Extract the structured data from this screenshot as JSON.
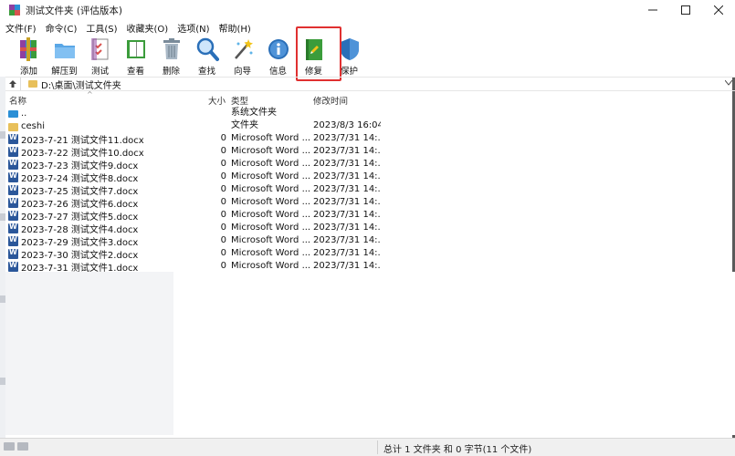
{
  "window": {
    "title": "测试文件夹 (评估版本)",
    "minimize_icon": "minimize-icon",
    "maximize_icon": "maximize-icon",
    "close_icon": "close-icon"
  },
  "menu": [
    "文件(F)",
    "命令(C)",
    "工具(S)",
    "收藏夹(O)",
    "选项(N)",
    "帮助(H)"
  ],
  "toolbar": [
    {
      "label": "添加",
      "icon": "add-archive-icon"
    },
    {
      "label": "解压到",
      "icon": "extract-folder-icon"
    },
    {
      "label": "测试",
      "icon": "test-checklist-icon"
    },
    {
      "label": "查看",
      "icon": "view-book-icon"
    },
    {
      "label": "删除",
      "icon": "trash-icon"
    },
    {
      "label": "查找",
      "icon": "magnifier-icon"
    },
    {
      "label": "向导",
      "icon": "wizard-wand-icon"
    },
    {
      "label": "信息",
      "icon": "info-icon"
    },
    {
      "label": "修复",
      "icon": "repair-book-icon"
    },
    {
      "label": "保护",
      "icon": "shield-icon"
    }
  ],
  "address": {
    "up_icon": "up-arrow-icon",
    "path": "D:\\桌面\\测试文件夹",
    "dropdown_icon": "chevron-down-icon"
  },
  "columns": {
    "name": "名称",
    "size": "大小",
    "type": "类型",
    "modified": "修改时间"
  },
  "files": [
    {
      "name": "..",
      "size": "",
      "type": "系统文件夹",
      "modified": "",
      "kind": "up"
    },
    {
      "name": "ceshi",
      "size": "",
      "type": "文件夹",
      "modified": "2023/8/3 16:04",
      "kind": "folder"
    },
    {
      "name": "2023-7-21 测试文件11.docx",
      "size": "0",
      "type": "Microsoft Word ...",
      "modified": "2023/7/31 14:...",
      "kind": "word"
    },
    {
      "name": "2023-7-22 测试文件10.docx",
      "size": "0",
      "type": "Microsoft Word ...",
      "modified": "2023/7/31 14:...",
      "kind": "word"
    },
    {
      "name": "2023-7-23 测试文件9.docx",
      "size": "0",
      "type": "Microsoft Word ...",
      "modified": "2023/7/31 14:...",
      "kind": "word"
    },
    {
      "name": "2023-7-24 测试文件8.docx",
      "size": "0",
      "type": "Microsoft Word ...",
      "modified": "2023/7/31 14:...",
      "kind": "word"
    },
    {
      "name": "2023-7-25 测试文件7.docx",
      "size": "0",
      "type": "Microsoft Word ...",
      "modified": "2023/7/31 14:...",
      "kind": "word"
    },
    {
      "name": "2023-7-26 测试文件6.docx",
      "size": "0",
      "type": "Microsoft Word ...",
      "modified": "2023/7/31 14:...",
      "kind": "word"
    },
    {
      "name": "2023-7-27 测试文件5.docx",
      "size": "0",
      "type": "Microsoft Word ...",
      "modified": "2023/7/31 14:...",
      "kind": "word"
    },
    {
      "name": "2023-7-28 测试文件4.docx",
      "size": "0",
      "type": "Microsoft Word ...",
      "modified": "2023/7/31 14:...",
      "kind": "word"
    },
    {
      "name": "2023-7-29 测试文件3.docx",
      "size": "0",
      "type": "Microsoft Word ...",
      "modified": "2023/7/31 14:...",
      "kind": "word"
    },
    {
      "name": "2023-7-30 测试文件2.docx",
      "size": "0",
      "type": "Microsoft Word ...",
      "modified": "2023/7/31 14:...",
      "kind": "word"
    },
    {
      "name": "2023-7-31 测试文件1.docx",
      "size": "0",
      "type": "Microsoft Word ...",
      "modified": "2023/7/31 14:...",
      "kind": "word"
    }
  ],
  "status": {
    "summary": "总计 1 文件夹 和 0 字节(11 个文件)"
  },
  "colors": {
    "highlight": "#e03030",
    "word_icon": "#2b579a",
    "folder_icon": "#e8c05a"
  }
}
